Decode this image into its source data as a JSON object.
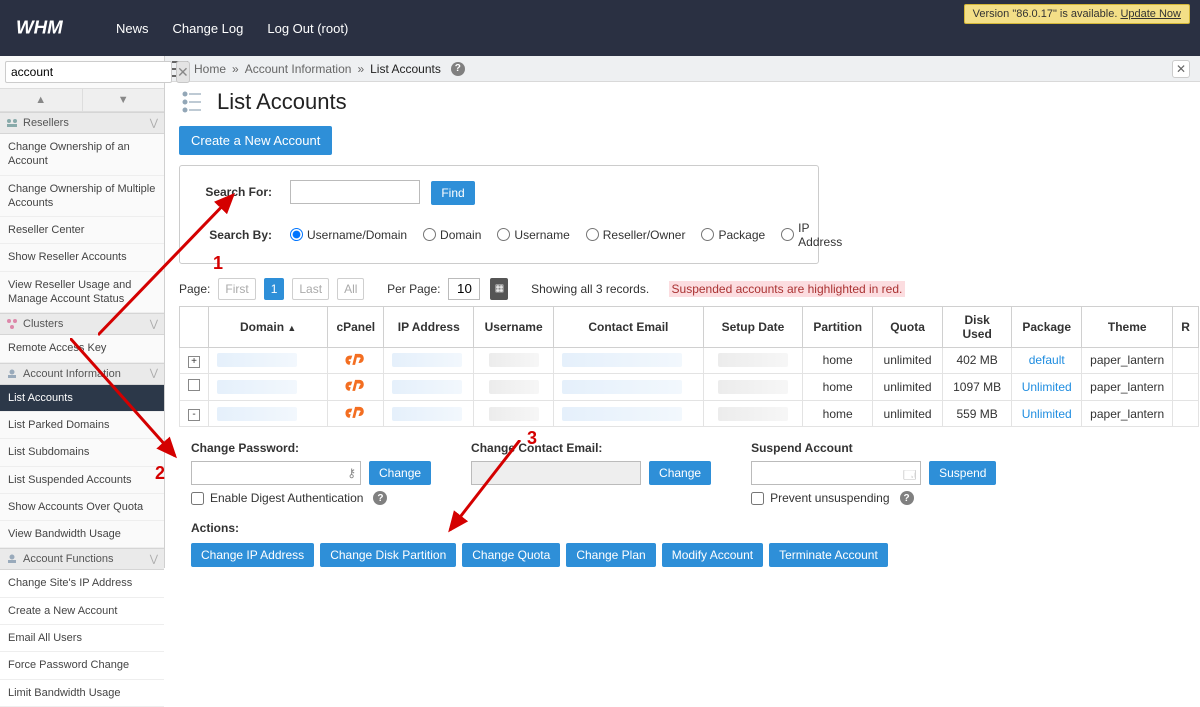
{
  "header": {
    "nav": [
      "News",
      "Change Log",
      "Log Out (root)"
    ],
    "update_banner_text": "Version \"86.0.17\" is available. ",
    "update_link": "Update Now"
  },
  "breadcrumb": {
    "home": "Home",
    "section": "Account Information",
    "page": "List Accounts"
  },
  "sidebar": {
    "search_value": "account",
    "cat_resellers": "Resellers",
    "resellers_items": [
      "Change Ownership of an Account",
      "Change Ownership of Multiple Accounts",
      "Reseller Center",
      "Show Reseller Accounts",
      "View Reseller Usage and Manage Account Status"
    ],
    "cat_clusters": "Clusters",
    "clusters_items": [
      "Remote Access Key"
    ],
    "cat_acctinfo": "Account Information",
    "acctinfo_items": [
      "List Accounts",
      "List Parked Domains",
      "List Subdomains",
      "List Suspended Accounts",
      "Show Accounts Over Quota",
      "View Bandwidth Usage"
    ],
    "cat_acctfunc": "Account Functions",
    "acctfunc_items": [
      "Change Site's IP Address",
      "Create a New Account",
      "Email All Users",
      "Force Password Change",
      "Limit Bandwidth Usage"
    ]
  },
  "page": {
    "title": "List Accounts",
    "create_btn": "Create a New Account"
  },
  "search": {
    "for_label": "Search For:",
    "find_btn": "Find",
    "by_label": "Search By:",
    "options": [
      "Username/Domain",
      "Domain",
      "Username",
      "Reseller/Owner",
      "Package",
      "IP Address"
    ]
  },
  "pager": {
    "page_label": "Page:",
    "first": "First",
    "one": "1",
    "last": "Last",
    "all": "All",
    "perpage_label": "Per Page:",
    "perpage_value": "10",
    "showing": "Showing all 3 records.",
    "suspended_note": "Suspended accounts are highlighted in red."
  },
  "table": {
    "headers": [
      "",
      "Domain",
      "cPanel",
      "IP Address",
      "Username",
      "Contact Email",
      "Setup Date",
      "Partition",
      "Quota",
      "Disk Used",
      "Package",
      "Theme",
      "R"
    ],
    "rows": [
      {
        "partition": "home",
        "quota": "unlimited",
        "disk": "402 MB",
        "package": "default",
        "package_link": false,
        "theme": "paper_lantern",
        "expand": "+"
      },
      {
        "partition": "home",
        "quota": "unlimited",
        "disk": "1097 MB",
        "package": "Unlimited",
        "package_link": true,
        "theme": "paper_lantern",
        "expand": ""
      },
      {
        "partition": "home",
        "quota": "unlimited",
        "disk": "559 MB",
        "package": "Unlimited",
        "package_link": true,
        "theme": "paper_lantern",
        "expand": "-"
      }
    ]
  },
  "expanded": {
    "change_password_label": "Change Password:",
    "change_btn": "Change",
    "enable_digest": "Enable Digest Authentication",
    "change_email_label": "Change Contact Email:",
    "suspend_label": "Suspend Account",
    "suspend_btn": "Suspend",
    "prevent_unsusp": "Prevent unsuspending",
    "actions_label": "Actions:",
    "action_btns": [
      "Change IP Address",
      "Change Disk Partition",
      "Change Quota",
      "Change Plan",
      "Modify Account",
      "Terminate Account"
    ]
  },
  "annotations": {
    "n1": "1",
    "n2": "2",
    "n3": "3"
  }
}
